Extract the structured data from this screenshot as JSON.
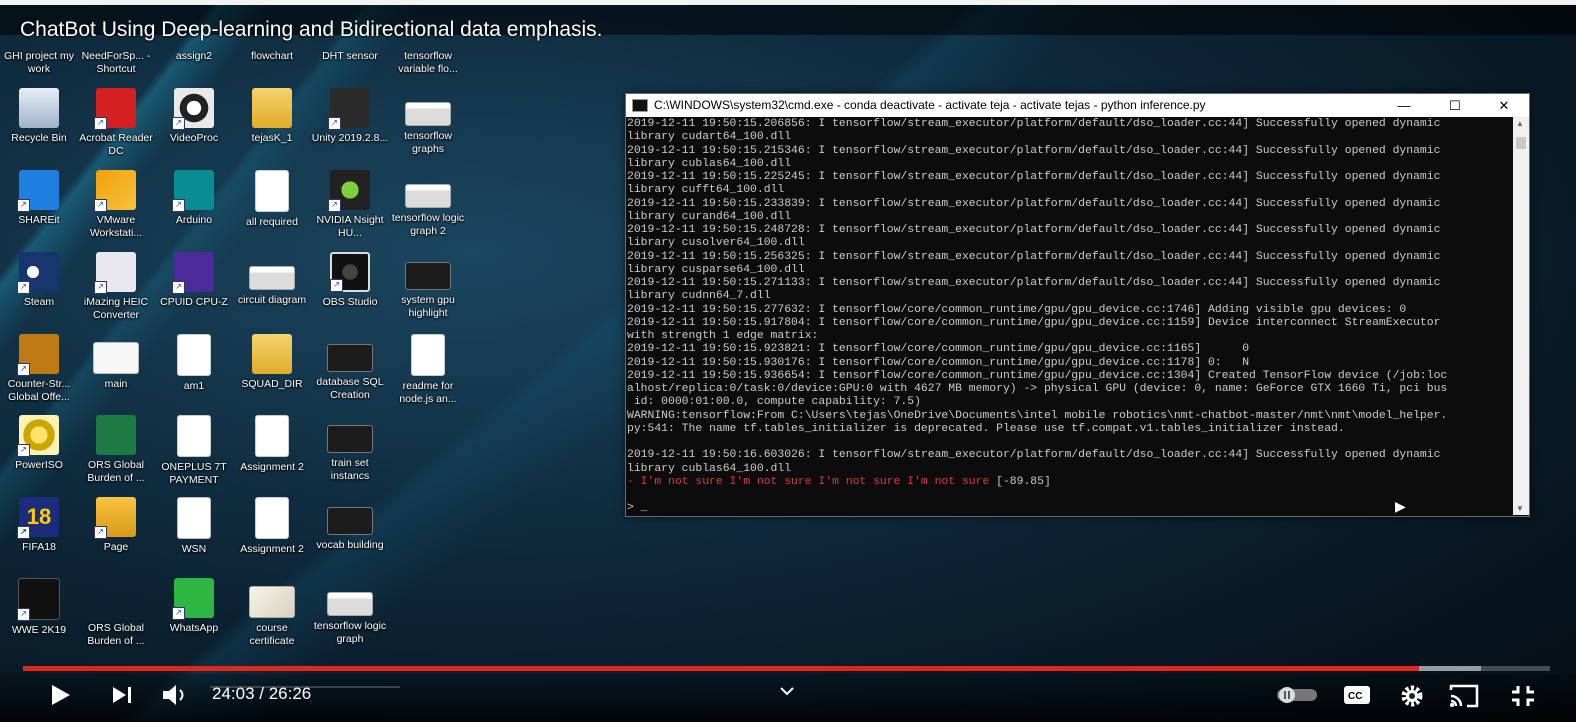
{
  "video": {
    "title": "ChatBot Using Deep-learning and Bidirectional data emphasis.",
    "time_current": "24:03",
    "time_separator": " / ",
    "time_total": "26:26",
    "progress_fraction": 0.9145,
    "buffered_fraction": 0.955
  },
  "desktop_icons": [
    {
      "label": "GHI project my work",
      "cls": "p-thumb",
      "col": 0,
      "row": -1
    },
    {
      "label": "NeedForSp... - Shortcut",
      "cls": "p-blank",
      "col": 1,
      "row": -1
    },
    {
      "label": "assign2",
      "cls": "p-blank",
      "col": 2,
      "row": -1
    },
    {
      "label": "flowchart",
      "cls": "p-blank",
      "col": 3,
      "row": -1
    },
    {
      "label": "DHT sensor",
      "cls": "p-blank",
      "col": 4,
      "row": -1
    },
    {
      "label": "tensorflow variable flo...",
      "cls": "p-blank",
      "col": 5,
      "row": -1
    },
    {
      "label": "Recycle Bin",
      "cls": "p-recycle",
      "col": 0,
      "row": 0
    },
    {
      "label": "Acrobat Reader DC",
      "cls": "p-acrobat",
      "col": 1,
      "row": 0,
      "sc": true
    },
    {
      "label": "VideoProc",
      "cls": "p-video",
      "col": 2,
      "row": 0,
      "sc": true
    },
    {
      "label": "tejasK_1",
      "cls": "p-folder",
      "col": 3,
      "row": 0
    },
    {
      "label": "Unity 2019.2.8...",
      "cls": "p-unity",
      "col": 4,
      "row": 0,
      "sc": true
    },
    {
      "label": "tensorflow graphs",
      "cls": "p-thumbwide",
      "col": 5,
      "row": 0
    },
    {
      "label": "SHAREit",
      "cls": "p-shareit",
      "col": 0,
      "row": 1,
      "sc": true
    },
    {
      "label": "VMware Workstati...",
      "cls": "p-vmware",
      "col": 1,
      "row": 1,
      "sc": true
    },
    {
      "label": "Arduino",
      "cls": "p-arduino",
      "col": 2,
      "row": 1,
      "sc": true
    },
    {
      "label": "all required",
      "cls": "p-doc",
      "col": 3,
      "row": 1
    },
    {
      "label": "NVIDIA Nsight HU...",
      "cls": "p-nvidia",
      "col": 4,
      "row": 1,
      "sc": true
    },
    {
      "label": "tensorflow logic graph 2",
      "cls": "p-thumbwide",
      "col": 5,
      "row": 1
    },
    {
      "label": "Steam",
      "cls": "p-steam",
      "col": 0,
      "row": 2,
      "sc": true
    },
    {
      "label": "iMazing HEIC Converter",
      "cls": "p-imazing",
      "col": 1,
      "row": 2,
      "sc": true
    },
    {
      "label": "CPUID CPU-Z",
      "cls": "p-cpuz",
      "col": 2,
      "row": 2,
      "sc": true
    },
    {
      "label": "circuit diagram",
      "cls": "p-thumbwide",
      "col": 3,
      "row": 2
    },
    {
      "label": "OBS Studio",
      "cls": "p-obs",
      "col": 4,
      "row": 2,
      "sc": true
    },
    {
      "label": "system gpu highlight",
      "cls": "p-dark",
      "col": 5,
      "row": 2
    },
    {
      "label": "Counter-Str... Global Offe...",
      "cls": "p-csgo",
      "col": 0,
      "row": 3,
      "sc": true
    },
    {
      "label": "main",
      "cls": "p-thumb",
      "col": 1,
      "row": 3
    },
    {
      "label": "am1",
      "cls": "p-doc",
      "col": 2,
      "row": 3
    },
    {
      "label": "SQUAD_DIR",
      "cls": "p-folder",
      "col": 3,
      "row": 3
    },
    {
      "label": "database SQL Creation",
      "cls": "p-dark",
      "col": 4,
      "row": 3
    },
    {
      "label": "readme for node.js an...",
      "cls": "p-doc",
      "col": 5,
      "row": 3
    },
    {
      "label": "PowerISO",
      "cls": "p-ps",
      "col": 0,
      "row": 4,
      "sc": true
    },
    {
      "label": "ORS Global Burden of ...",
      "cls": "p-excel",
      "col": 1,
      "row": 4
    },
    {
      "label": "ONEPLUS 7T PAYMENT",
      "cls": "p-doc",
      "col": 2,
      "row": 4
    },
    {
      "label": "Assignment 2",
      "cls": "p-doc",
      "col": 3,
      "row": 4
    },
    {
      "label": "train set instancs",
      "cls": "p-dark",
      "col": 4,
      "row": 4
    },
    {
      "label": "FIFA18",
      "cls": "p-fifa",
      "col": 0,
      "row": 5,
      "sc": true,
      "glyph": "18"
    },
    {
      "label": "Page",
      "cls": "p-page",
      "col": 1,
      "row": 5,
      "sc": true
    },
    {
      "label": "WSN",
      "cls": "p-wsn",
      "col": 2,
      "row": 5
    },
    {
      "label": "Assignment 2",
      "cls": "p-doc",
      "col": 3,
      "row": 5
    },
    {
      "label": "vocab building",
      "cls": "p-dark",
      "col": 4,
      "row": 5
    },
    {
      "label": "WWE 2K19",
      "cls": "p-wwe",
      "col": 0,
      "row": 6,
      "sc": true
    },
    {
      "label": "ORS Global Burden of ...",
      "cls": "p-blank",
      "col": 1,
      "row": 6
    },
    {
      "label": "WhatsApp",
      "cls": "p-whatsapp",
      "col": 2,
      "row": 6,
      "sc": true
    },
    {
      "label": "course certificate",
      "cls": "p-cert",
      "col": 3,
      "row": 6
    },
    {
      "label": "tensorflow logic graph",
      "cls": "p-thumbwide",
      "col": 4,
      "row": 6
    }
  ],
  "cmd": {
    "title": "C:\\WINDOWS\\system32\\cmd.exe - conda  deactivate - activate  teja - activate  tejas - python  inference.py",
    "minimize": "—",
    "maximize": "☐",
    "close": "✕",
    "lines": [
      {
        "t": "2019-12-11 19:50:15.206856: I tensorflow/stream_executor/platform/default/dso_loader.cc:44] Successfully opened dynamic"
      },
      {
        "t": "library cudart64_100.dll"
      },
      {
        "t": "2019-12-11 19:50:15.215346: I tensorflow/stream_executor/platform/default/dso_loader.cc:44] Successfully opened dynamic"
      },
      {
        "t": "library cublas64_100.dll"
      },
      {
        "t": "2019-12-11 19:50:15.225245: I tensorflow/stream_executor/platform/default/dso_loader.cc:44] Successfully opened dynamic"
      },
      {
        "t": "library cufft64_100.dll"
      },
      {
        "t": "2019-12-11 19:50:15.233839: I tensorflow/stream_executor/platform/default/dso_loader.cc:44] Successfully opened dynamic"
      },
      {
        "t": "library curand64_100.dll"
      },
      {
        "t": "2019-12-11 19:50:15.248728: I tensorflow/stream_executor/platform/default/dso_loader.cc:44] Successfully opened dynamic"
      },
      {
        "t": "library cusolver64_100.dll"
      },
      {
        "t": "2019-12-11 19:50:15.256325: I tensorflow/stream_executor/platform/default/dso_loader.cc:44] Successfully opened dynamic"
      },
      {
        "t": "library cusparse64_100.dll"
      },
      {
        "t": "2019-12-11 19:50:15.271133: I tensorflow/stream_executor/platform/default/dso_loader.cc:44] Successfully opened dynamic"
      },
      {
        "t": "library cudnn64_7.dll"
      },
      {
        "t": "2019-12-11 19:50:15.277632: I tensorflow/core/common_runtime/gpu/gpu_device.cc:1746] Adding visible gpu devices: 0"
      },
      {
        "t": "2019-12-11 19:50:15.917804: I tensorflow/core/common_runtime/gpu/gpu_device.cc:1159] Device interconnect StreamExecutor"
      },
      {
        "t": "with strength 1 edge matrix:"
      },
      {
        "t": "2019-12-11 19:50:15.923821: I tensorflow/core/common_runtime/gpu/gpu_device.cc:1165]      0"
      },
      {
        "t": "2019-12-11 19:50:15.930176: I tensorflow/core/common_runtime/gpu/gpu_device.cc:1178] 0:   N"
      },
      {
        "t": "2019-12-11 19:50:15.936654: I tensorflow/core/common_runtime/gpu/gpu_device.cc:1304] Created TensorFlow device (/job:loc"
      },
      {
        "t": "alhost/replica:0/task:0/device:GPU:0 with 4627 MB memory) -> physical GPU (device: 0, name: GeForce GTX 1660 Ti, pci bus"
      },
      {
        "t": " id: 0000:01:00.0, compute capability: 7.5)"
      },
      {
        "t": "WARNING:tensorflow:From C:\\Users\\tejas\\OneDrive\\Documents\\intel mobile robotics\\nmt-chatbot-master/nmt\\nmt\\model_helper."
      },
      {
        "t": "py:541: The name tf.tables_initializer is deprecated. Please use tf.compat.v1.tables_initializer instead."
      },
      {
        "t": ""
      },
      {
        "t": "2019-12-11 19:50:16.603026: I tensorflow/stream_executor/platform/default/dso_loader.cc:44] Successfully opened dynamic"
      },
      {
        "t": "library cublas64_100.dll"
      },
      {
        "t": "- I'm not sure I'm not sure I'm not sure I'm not sure",
        "score": " [-89.85]"
      },
      {
        "t": ""
      },
      {
        "t": "> _"
      }
    ]
  },
  "colors": {
    "progress": "#e1261c",
    "cmd_text": "#cccccc",
    "cmd_red": "#e03a3a"
  },
  "icons": [
    "play-icon",
    "next-icon",
    "volume-icon",
    "chevron-down-icon",
    "autoplay-toggle-icon",
    "captions-icon",
    "settings-gear-icon",
    "cast-icon",
    "fullscreen-exit-icon"
  ]
}
